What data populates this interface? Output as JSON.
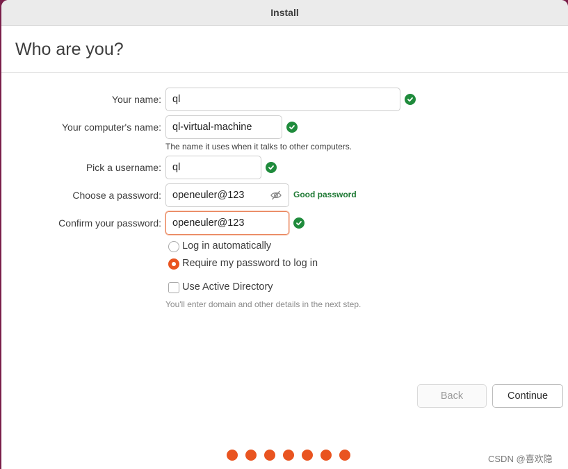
{
  "window": {
    "title": "Install"
  },
  "page": {
    "heading": "Who are you?"
  },
  "form": {
    "name": {
      "label": "Your name:",
      "value": "ql"
    },
    "computer": {
      "label": "Your computer's name:",
      "value": "ql-virtual-machine",
      "hint": "The name it uses when it talks to other computers."
    },
    "username": {
      "label": "Pick a username:",
      "value": "ql"
    },
    "password": {
      "label": "Choose a password:",
      "value": "openeuler@123",
      "strength": "Good password"
    },
    "confirm": {
      "label": "Confirm your password:",
      "value": "openeuler@123"
    },
    "login_options": [
      {
        "label": "Log in automatically",
        "selected": false
      },
      {
        "label": "Require my password to log in",
        "selected": true
      }
    ],
    "active_directory": {
      "label": "Use Active Directory",
      "checked": false,
      "hint": "You'll enter domain and other details in the next step."
    }
  },
  "buttons": {
    "back": "Back",
    "continue": "Continue"
  },
  "progress": {
    "total_steps": 7
  },
  "watermark": "CSDN @喜欢隐",
  "colors": {
    "accent": "#e95420",
    "valid": "#1f8b3c",
    "good_password": "#1f7a35"
  }
}
